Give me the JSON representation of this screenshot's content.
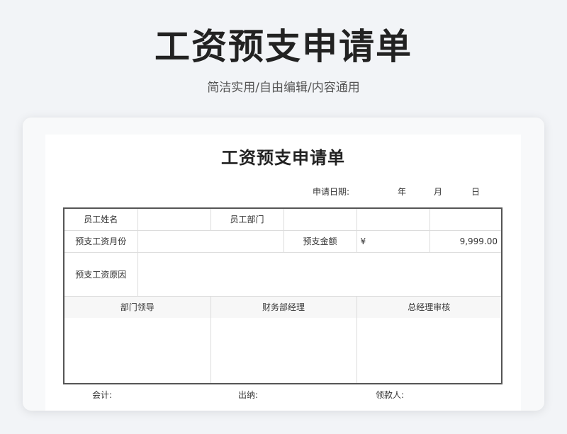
{
  "hero": {
    "title": "工资预支申请单",
    "subtitle": "简洁实用/自由编辑/内容通用"
  },
  "form": {
    "title": "工资预支申请单",
    "date": {
      "label": "申请日期:",
      "year": "年",
      "month": "月",
      "day": "日"
    },
    "rows": {
      "employee_name_label": "员工姓名",
      "employee_name_value": "",
      "department_label": "员工部门",
      "department_value": "",
      "extra_cell_1": "",
      "extra_cell_2": "",
      "month_label": "预支工资月份",
      "month_value": "",
      "amount_label": "预支金额",
      "currency_symbol": "¥",
      "amount_value": "9,999.00",
      "reason_label": "预支工资原因",
      "reason_value": ""
    },
    "approvals": {
      "dept_leader": "部门领导",
      "finance_manager": "财务部经理",
      "gm_review": "总经理审核"
    },
    "footer": {
      "accountant": "会计:",
      "cashier": "出纳:",
      "recipient": "领款人:"
    }
  }
}
